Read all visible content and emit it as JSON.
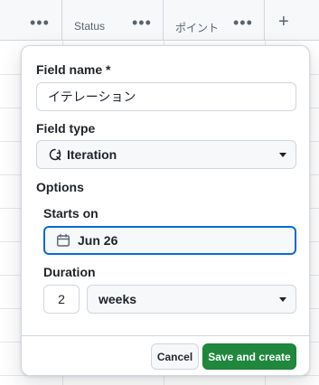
{
  "table_header": {
    "status_label": "Status",
    "points_label": "ポイント",
    "more_glyph": "•••",
    "add_glyph": "+"
  },
  "form": {
    "field_name_label": "Field name *",
    "field_name_value": "イテレーション",
    "field_type_label": "Field type",
    "field_type_value": "Iteration",
    "field_type_icon": "iteration-icon",
    "options_label": "Options",
    "starts_on_label": "Starts on",
    "starts_on_value": "Jun 26",
    "starts_on_icon": "calendar-icon",
    "duration_label": "Duration",
    "duration_value": "2",
    "duration_unit": "weeks"
  },
  "actions": {
    "cancel_label": "Cancel",
    "save_label": "Save and create"
  },
  "colors": {
    "primary_green": "#1f883d",
    "focus_blue": "#0969da",
    "border": "#d0d7de"
  }
}
